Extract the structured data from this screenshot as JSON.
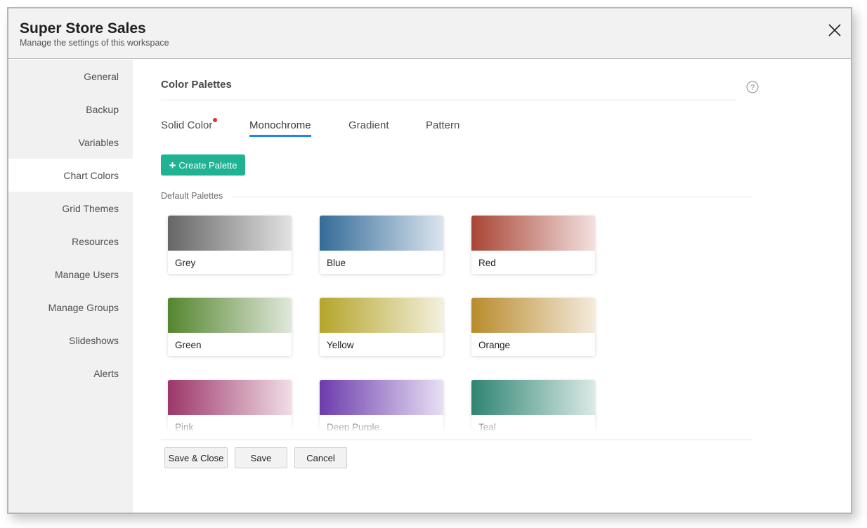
{
  "header": {
    "title": "Super Store Sales",
    "subtitle": "Manage the settings of this workspace",
    "close_icon": "close-icon"
  },
  "sidebar": {
    "items": [
      {
        "label": "General",
        "active": false
      },
      {
        "label": "Backup",
        "active": false
      },
      {
        "label": "Variables",
        "active": false
      },
      {
        "label": "Chart Colors",
        "active": true
      },
      {
        "label": "Grid Themes",
        "active": false
      },
      {
        "label": "Resources",
        "active": false
      },
      {
        "label": "Manage Users",
        "active": false
      },
      {
        "label": "Manage Groups",
        "active": false
      },
      {
        "label": "Slideshows",
        "active": false
      },
      {
        "label": "Alerts",
        "active": false
      }
    ]
  },
  "main": {
    "section_title": "Color Palettes",
    "help_icon": "help-circle-icon",
    "tabs": [
      {
        "label": "Solid Color",
        "active": false,
        "has_notification_dot": true
      },
      {
        "label": "Monochrome",
        "active": true,
        "has_notification_dot": false
      },
      {
        "label": "Gradient",
        "active": false,
        "has_notification_dot": false
      },
      {
        "label": "Pattern",
        "active": false,
        "has_notification_dot": false
      }
    ],
    "create_button": {
      "icon": "plus-icon",
      "label": "Create Palette"
    },
    "group_label": "Default Palettes",
    "palettes": [
      {
        "name": "Grey",
        "from": "#666666",
        "to": "#e2e2e2"
      },
      {
        "name": "Blue",
        "from": "#346b99",
        "to": "#dbe5ee"
      },
      {
        "name": "Red",
        "from": "#a94534",
        "to": "#f2e0df"
      },
      {
        "name": "Green",
        "from": "#55862f",
        "to": "#e0e8db"
      },
      {
        "name": "Yellow",
        "from": "#b5a52b",
        "to": "#f3f0dd"
      },
      {
        "name": "Orange",
        "from": "#b98b2c",
        "to": "#f3ebdc"
      },
      {
        "name": "Pink",
        "from": "#9c3769",
        "to": "#f0dde6"
      },
      {
        "name": "Deep Purple",
        "from": "#6d3cad",
        "to": "#e7e0f3"
      },
      {
        "name": "Teal",
        "from": "#2f8472",
        "to": "#dbeae6"
      }
    ]
  },
  "footer": {
    "save_close_label": "Save & Close",
    "save_label": "Save",
    "cancel_label": "Cancel"
  },
  "colors": {
    "accent": "#1fb394",
    "tab_underline": "#1f87e5",
    "notification_dot": "#f02d2d"
  }
}
